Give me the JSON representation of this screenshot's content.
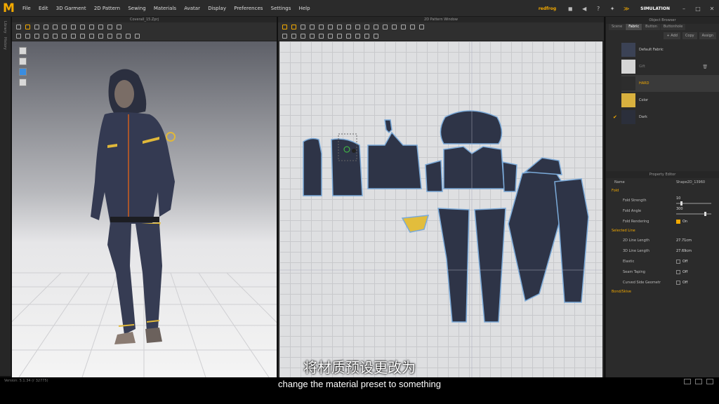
{
  "menu": [
    "File",
    "Edit",
    "3D Garment",
    "2D Pattern",
    "Sewing",
    "Materials",
    "Avatar",
    "Display",
    "Preferences",
    "Settings",
    "Help"
  ],
  "user": "redfrog",
  "mode": "SIMULATION",
  "left_tabs": [
    "Library",
    "History"
  ],
  "view3d": {
    "title": "Coverall_15.Zprj"
  },
  "view2d": {
    "title": "2D Pattern Window"
  },
  "object_browser": {
    "title": "Object Browser",
    "tabs": [
      "Scene",
      "Fabric",
      "Button",
      "Buttonhole"
    ],
    "active_tab": "Fabric",
    "actions": [
      "+ Add",
      "Copy",
      "Assign"
    ],
    "fabrics": [
      {
        "name": "Default Fabric",
        "color": "#3b4255",
        "selected": false,
        "applied": false
      },
      {
        "name": "Gift",
        "color": "#d6d6d6",
        "selected": false,
        "applied": false
      },
      {
        "name": "HARD",
        "color": "#2d2d2d",
        "selected": true,
        "applied": false
      },
      {
        "name": "Color",
        "color": "#d9b13e",
        "selected": false,
        "applied": false
      },
      {
        "name": "Dark",
        "color": "#2b2f3b",
        "selected": false,
        "applied": true
      }
    ]
  },
  "property_editor": {
    "title": "Property Editor",
    "name_label": "Name",
    "name_value": "Shape2D_13960",
    "fold_section": "Fold",
    "fold_strength_label": "Fold Strength",
    "fold_strength_value": "10",
    "fold_angle_label": "Fold Angle",
    "fold_angle_value": "300",
    "fold_rendering_label": "Fold Rendering",
    "fold_rendering_value": "On",
    "selected_line_section": "Selected Line",
    "line_2d_label": "2D Line Length",
    "line_2d_value": "27.71cm",
    "line_3d_label": "3D Line Length",
    "line_3d_value": "27.69cm",
    "elastic_label": "Elastic",
    "elastic_value": "Off",
    "seam_taping_label": "Seam Taping",
    "seam_taping_value": "Off",
    "curved_label": "Curved Side Geometr",
    "curved_value": "Off",
    "bond_section": "Bond/Skive"
  },
  "status": "Version: 5.1.34 (r 32775)",
  "subtitle_cn": "将材质预设更改为",
  "subtitle_en": "change the material preset to something"
}
